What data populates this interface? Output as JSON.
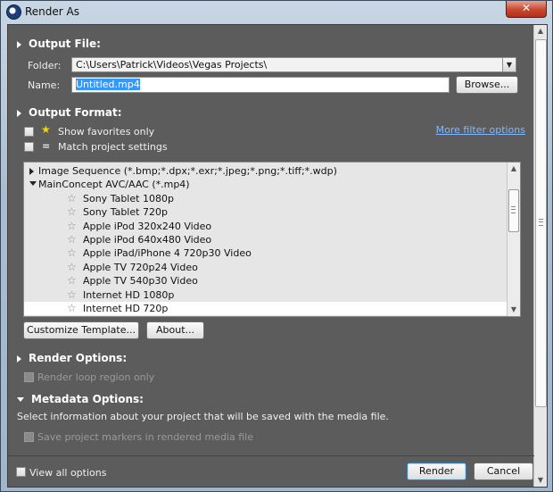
{
  "window": {
    "title": "Render As",
    "close_label": "✕"
  },
  "output_file": {
    "heading": "Output File:",
    "folder_label": "Folder:",
    "folder_value": "C:\\Users\\Patrick\\Videos\\Vegas Projects\\",
    "name_label": "Name:",
    "name_value": "Untitled.mp4",
    "browse_label": "Browse..."
  },
  "output_format": {
    "heading": "Output Format:",
    "show_favorites_label": "Show favorites only",
    "match_project_label": "Match project settings",
    "more_filter_label": "More filter options",
    "tree": [
      {
        "label": "Image Sequence (*.bmp;*.dpx;*.exr;*.jpeg;*.png;*.tiff;*.wdp)",
        "level": 0,
        "expanded": false
      },
      {
        "label": "MainConcept AVC/AAC (*.mp4)",
        "level": 0,
        "expanded": true
      },
      {
        "label": "Sony Tablet 1080p",
        "level": 1
      },
      {
        "label": "Sony Tablet 720p",
        "level": 1
      },
      {
        "label": "Apple iPod 320x240 Video",
        "level": 1
      },
      {
        "label": "Apple iPod 640x480 Video",
        "level": 1
      },
      {
        "label": "Apple iPad/iPhone 4 720p30 Video",
        "level": 1
      },
      {
        "label": "Apple TV 720p24 Video",
        "level": 1
      },
      {
        "label": "Apple TV 540p30 Video",
        "level": 1
      },
      {
        "label": "Internet HD 1080p",
        "level": 1
      },
      {
        "label": "Internet HD 720p",
        "level": 1,
        "selected": true
      }
    ],
    "customize_label": "Customize Template...",
    "about_label": "About..."
  },
  "render_options": {
    "heading": "Render Options:",
    "loop_region_label": "Render loop region only"
  },
  "metadata_options": {
    "heading": "Metadata Options:",
    "description": "Select information about your project that will be saved with the media file.",
    "markers_label": "Save project markers in rendered media file"
  },
  "footer": {
    "view_all_label": "View all options",
    "render_label": "Render",
    "cancel_label": "Cancel"
  },
  "colors": {
    "panel_bg": "#5c5c5c",
    "link": "#7fb8ff",
    "selection": "#3399ff"
  }
}
